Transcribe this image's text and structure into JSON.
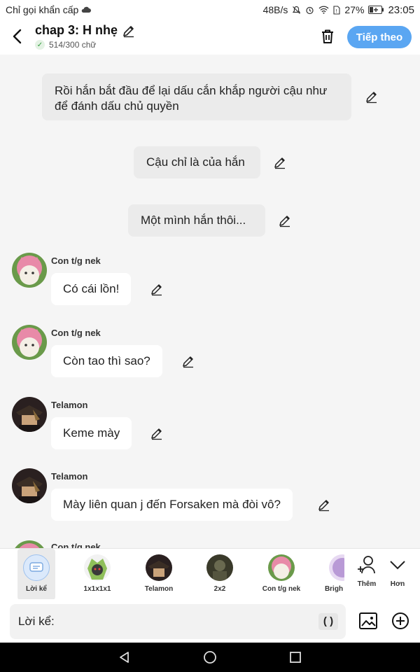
{
  "status_bar": {
    "carrier": "Chỉ gọi khẩn cấp",
    "speed": "48B/s",
    "battery": "27%",
    "time": "23:05"
  },
  "header": {
    "title": "chap 3: H nhẹ",
    "word_count": "514/300 chữ",
    "next_label": "Tiếp theo"
  },
  "chat": {
    "narrations": [
      {
        "text": "Rồi hắn bắt đầu để lại dấu cắn khắp người cậu như để đánh dấu chủ quyền"
      },
      {
        "text": "Cậu chỉ là của hắn"
      },
      {
        "text": "Một mình hắn thôi..."
      }
    ],
    "messages": [
      {
        "name": "Con t/g nek",
        "text": "Có cái lồn!",
        "avatar": "pink-cat-avatar"
      },
      {
        "name": "Con t/g nek",
        "text": "Còn tao thì sao?",
        "avatar": "pink-cat-avatar"
      },
      {
        "name": "Telamon",
        "text": "Keme mày",
        "avatar": "dark-hat-avatar"
      },
      {
        "name": "Telamon",
        "text": "Mày liên quan j đến Forsaken mà đòi vô?",
        "avatar": "dark-hat-avatar"
      },
      {
        "name": "Con t/g nek",
        "text": "",
        "avatar": "pink-cat-avatar"
      }
    ]
  },
  "character_bar": {
    "items": [
      {
        "name": "Lời kể"
      },
      {
        "name": "1x1x1x1"
      },
      {
        "name": "Telamon"
      },
      {
        "name": "2x2"
      },
      {
        "name": "Con t/g nek"
      },
      {
        "name": "Brigh"
      }
    ],
    "add_label": "Thêm",
    "more_label": "Hơn"
  },
  "input": {
    "placeholder": "Lời kể:",
    "paren_label": "( )"
  },
  "colors": {
    "accent": "#5aa6f2",
    "bubble": "#ffffff",
    "narration_bg": "#ebebeb",
    "background": "#f5f5f5"
  }
}
